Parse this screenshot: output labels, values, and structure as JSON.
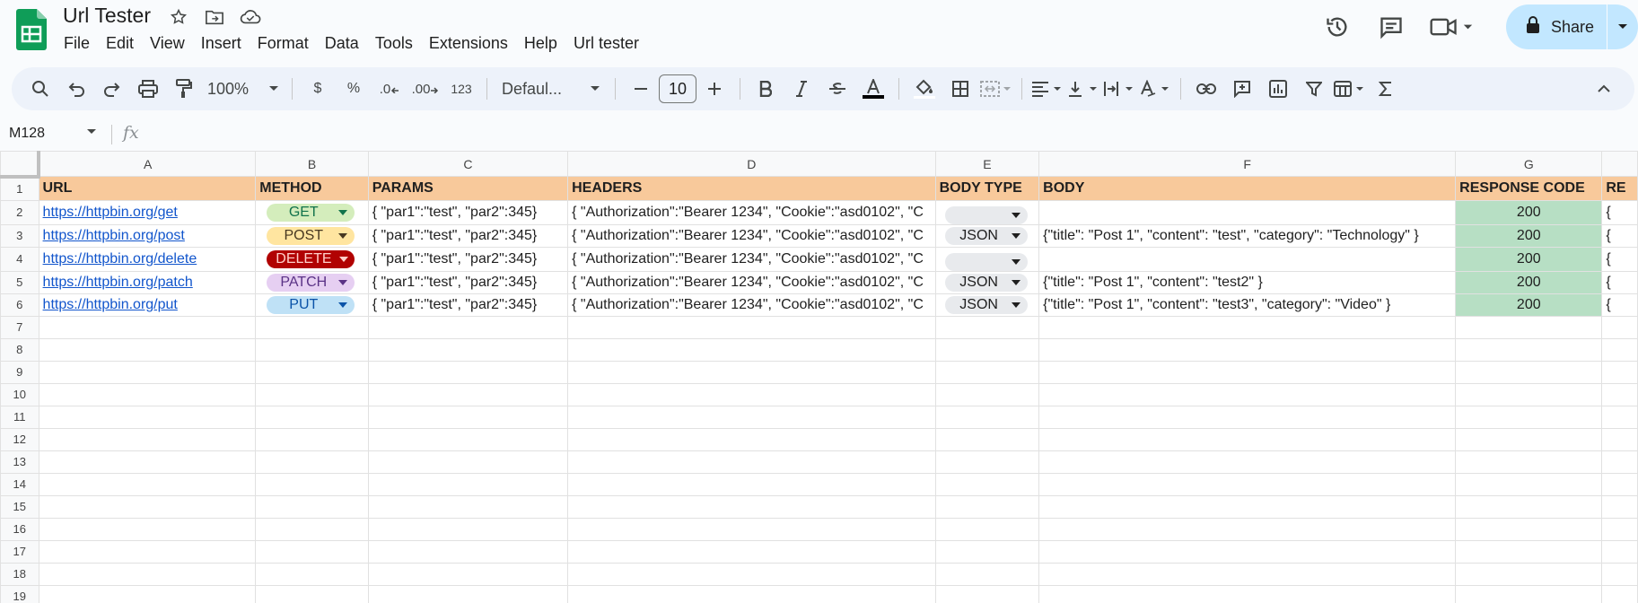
{
  "app": {
    "title": "Url Tester",
    "menu": [
      "File",
      "Edit",
      "View",
      "Insert",
      "Format",
      "Data",
      "Tools",
      "Extensions",
      "Help",
      "Url tester"
    ],
    "share_label": "Share"
  },
  "toolbar": {
    "zoom": "100%",
    "currency": "$",
    "percent": "%",
    "dec_decrease": ".0",
    "dec_increase": ".00",
    "number_format": "123",
    "font": "Defaul...",
    "font_size": "10"
  },
  "formula_bar": {
    "cell_ref": "M128",
    "fx": "fx",
    "value": ""
  },
  "columns": [
    "A",
    "B",
    "C",
    "D",
    "E",
    "F",
    "G",
    ""
  ],
  "header_row": [
    "URL",
    "METHOD",
    "PARAMS",
    "HEADERS",
    "BODY TYPE",
    "BODY",
    "RESPONSE CODE",
    "RE"
  ],
  "rows": [
    {
      "num": "2",
      "url": "https://httpbin.org/get",
      "method": "GET",
      "params": "{ \"par1\":\"test\", \"par2\":345}",
      "headers": "{ \"Authorization\":\"Bearer 1234\", \"Cookie\":\"asd0102\", \"C",
      "body_type": "",
      "body": "",
      "response": "200",
      "extra": "{"
    },
    {
      "num": "3",
      "url": "https://httpbin.org/post",
      "method": "POST",
      "params": "{ \"par1\":\"test\", \"par2\":345}",
      "headers": "{ \"Authorization\":\"Bearer 1234\", \"Cookie\":\"asd0102\", \"C",
      "body_type": "JSON",
      "body": "{\"title\": \"Post 1\", \"content\": \"test\", \"category\": \"Technology\" }",
      "response": "200",
      "extra": "{"
    },
    {
      "num": "4",
      "url": "https://httpbin.org/delete",
      "method": "DELETE",
      "params": "{ \"par1\":\"test\", \"par2\":345}",
      "headers": "{ \"Authorization\":\"Bearer 1234\", \"Cookie\":\"asd0102\", \"C",
      "body_type": "",
      "body": "",
      "response": "200",
      "extra": "{"
    },
    {
      "num": "5",
      "url": "https://httpbin.org/patch",
      "method": "PATCH",
      "params": "{ \"par1\":\"test\", \"par2\":345}",
      "headers": "{ \"Authorization\":\"Bearer 1234\", \"Cookie\":\"asd0102\", \"C",
      "body_type": "JSON",
      "body": "{\"title\": \"Post 1\", \"content\": \"test2\" }",
      "response": "200",
      "extra": "{"
    },
    {
      "num": "6",
      "url": "https://httpbin.org/put",
      "method": "PUT",
      "params": "{ \"par1\":\"test\", \"par2\":345}",
      "headers": "{ \"Authorization\":\"Bearer 1234\", \"Cookie\":\"asd0102\", \"C",
      "body_type": "JSON",
      "body": "{\"title\": \"Post 1\", \"content\": \"test3\", \"category\": \"Video\" }",
      "response": "200",
      "extra": "{"
    }
  ],
  "empty_rows": [
    "7",
    "8",
    "9",
    "10",
    "11",
    "12",
    "13",
    "14",
    "15",
    "16",
    "17",
    "18",
    "19"
  ],
  "header_row_num": "1",
  "method_colors": {
    "GET": {
      "bg": "#d4edbc",
      "fg": "#11734b"
    },
    "POST": {
      "bg": "#ffe5a0",
      "fg": "#473821"
    },
    "DELETE": {
      "bg": "#b10202",
      "fg": "#ffcfc9"
    },
    "PATCH": {
      "bg": "#e6cff2",
      "fg": "#5a3286"
    },
    "PUT": {
      "bg": "#bfe1f6",
      "fg": "#0a53a8"
    }
  },
  "colors": {
    "header_fill": "#f8c99b",
    "response_fill": "#b7dfc4",
    "share_bg": "#c2e7ff",
    "toolbar_bg": "#edf2fa",
    "link": "#1155cc"
  }
}
